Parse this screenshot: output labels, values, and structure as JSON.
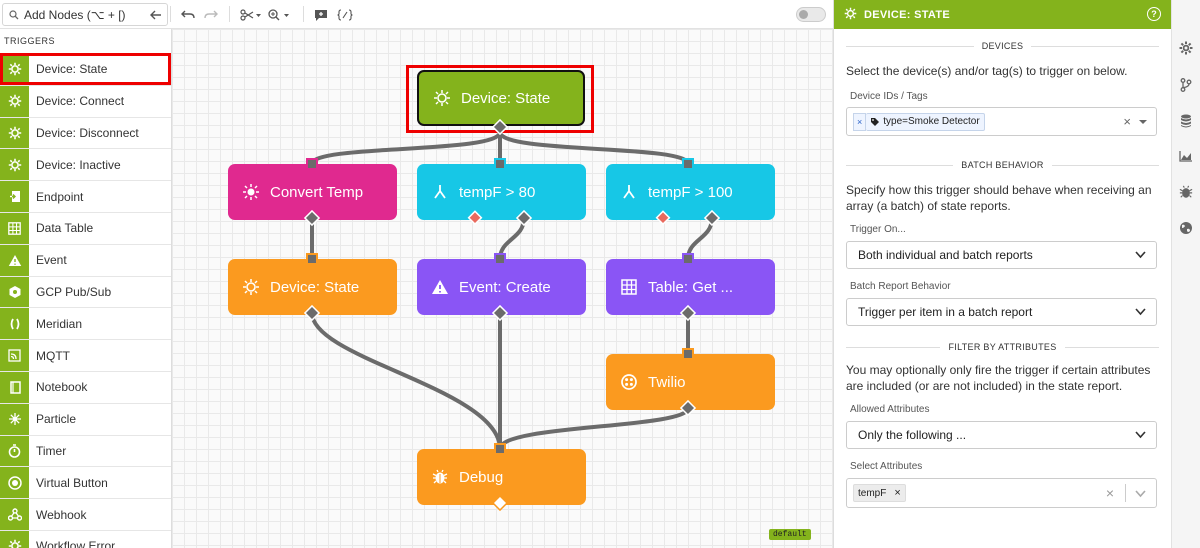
{
  "toolbar": {
    "search_placeholder": "Add Nodes (⌥ + [)"
  },
  "sidebar": {
    "section_title": "TRIGGERS",
    "items": [
      {
        "label": "Device: State",
        "icon": "device-state-icon"
      },
      {
        "label": "Device: Connect",
        "icon": "device-connect-icon"
      },
      {
        "label": "Device: Disconnect",
        "icon": "device-disconnect-icon"
      },
      {
        "label": "Device: Inactive",
        "icon": "device-inactive-icon"
      },
      {
        "label": "Endpoint",
        "icon": "endpoint-icon"
      },
      {
        "label": "Data Table",
        "icon": "table-icon"
      },
      {
        "label": "Event",
        "icon": "warning-icon"
      },
      {
        "label": "GCP Pub/Sub",
        "icon": "gcp-icon"
      },
      {
        "label": "Meridian",
        "icon": "meridian-icon"
      },
      {
        "label": "MQTT",
        "icon": "mqtt-icon"
      },
      {
        "label": "Notebook",
        "icon": "notebook-icon"
      },
      {
        "label": "Particle",
        "icon": "particle-icon"
      },
      {
        "label": "Timer",
        "icon": "timer-icon"
      },
      {
        "label": "Virtual Button",
        "icon": "button-icon"
      },
      {
        "label": "Webhook",
        "icon": "webhook-icon"
      },
      {
        "label": "Workflow Error",
        "icon": "workflow-error-icon"
      }
    ]
  },
  "canvas": {
    "nodes": {
      "trigger": "Device: State",
      "convert": "Convert Temp",
      "cond80": "tempF > 80",
      "cond100": "tempF > 100",
      "devstate": "Device: State",
      "event": "Event: Create",
      "tableget": "Table: Get ...",
      "twilio": "Twilio",
      "debug": "Debug"
    },
    "colors": {
      "trigger": "#84b31c",
      "function": "#e0298f",
      "conditional": "#17c7e6",
      "output": "#fb9a1f",
      "data": "#8a55f5"
    },
    "badge": "default"
  },
  "panel": {
    "title": "DEVICE: STATE",
    "devices_heading": "DEVICES",
    "devices_text": "Select the device(s) and/or tag(s) to trigger on below.",
    "device_ids_label": "Device IDs / Tags",
    "device_tag": "type=Smoke Detector",
    "batch_heading": "BATCH BEHAVIOR",
    "batch_text": "Specify how this trigger should behave when receiving an array (a batch) of state reports.",
    "trigger_on_label": "Trigger On...",
    "trigger_on_value": "Both individual and batch reports",
    "batch_report_label": "Batch Report Behavior",
    "batch_report_value": "Trigger per item in a batch report",
    "filter_heading": "FILTER BY ATTRIBUTES",
    "filter_text": "You may optionally only fire the trigger if certain attributes are included (or are not included) in the state report.",
    "allowed_label": "Allowed Attributes",
    "allowed_value": "Only the following ...",
    "select_attrs_label": "Select Attributes",
    "attr_tag": "tempF"
  }
}
